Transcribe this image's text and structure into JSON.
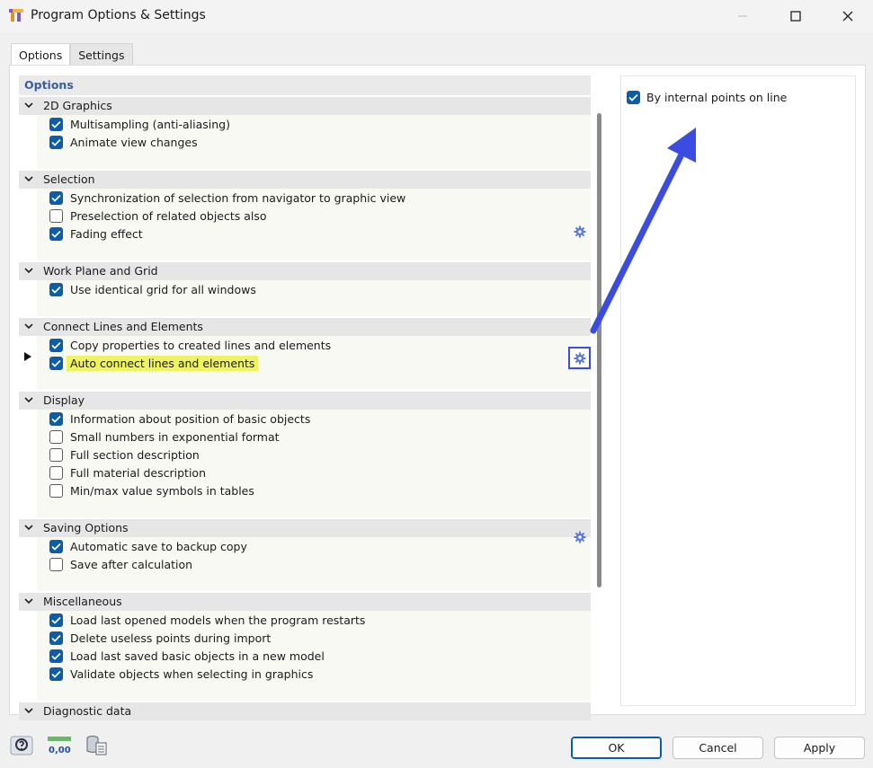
{
  "window": {
    "title": "Program Options & Settings"
  },
  "tabs": [
    {
      "label": "Options",
      "active": true
    },
    {
      "label": "Settings",
      "active": false
    }
  ],
  "options_pane": {
    "header": "Options",
    "groups": [
      {
        "title": "2D Graphics",
        "items": [
          {
            "label": "Multisampling (anti-aliasing)",
            "checked": true
          },
          {
            "label": "Animate view changes",
            "checked": true
          }
        ]
      },
      {
        "title": "Selection",
        "items": [
          {
            "label": "Synchronization of selection from navigator to graphic view",
            "checked": true
          },
          {
            "label": "Preselection of related objects also",
            "checked": false
          },
          {
            "label": "Fading effect",
            "checked": true
          }
        ]
      },
      {
        "title": "Work Plane and Grid",
        "items": [
          {
            "label": "Use identical grid for all windows",
            "checked": true
          }
        ]
      },
      {
        "title": "Connect Lines and Elements",
        "items": [
          {
            "label": "Copy properties to created lines and elements",
            "checked": true
          },
          {
            "label": "Auto connect lines and elements",
            "checked": true
          }
        ]
      },
      {
        "title": "Display",
        "items": [
          {
            "label": "Information about position of basic objects",
            "checked": true
          },
          {
            "label": "Small numbers in exponential format",
            "checked": false
          },
          {
            "label": "Full section description",
            "checked": false
          },
          {
            "label": "Full material description",
            "checked": false
          },
          {
            "label": "Min/max value symbols in tables",
            "checked": false
          }
        ]
      },
      {
        "title": "Saving Options",
        "items": [
          {
            "label": "Automatic save to backup copy",
            "checked": true
          },
          {
            "label": "Save after calculation",
            "checked": false
          }
        ]
      },
      {
        "title": "Miscellaneous",
        "items": [
          {
            "label": "Load last opened models when the program restarts",
            "checked": true
          },
          {
            "label": "Delete useless points during import",
            "checked": true
          },
          {
            "label": "Load last saved basic objects in a new model",
            "checked": true
          },
          {
            "label": "Validate objects when selecting in graphics",
            "checked": true
          }
        ]
      },
      {
        "title": "Diagnostic data",
        "items": []
      }
    ]
  },
  "detail_pane": {
    "items": [
      {
        "label": "By internal points on line",
        "checked": true
      }
    ]
  },
  "footer": {
    "ok": "OK",
    "cancel": "Cancel",
    "apply": "Apply",
    "units_icon_text": "0,00"
  },
  "colors": {
    "accent": "#0b5cad",
    "highlight": "#eef45e",
    "arrow": "#3b4de0",
    "header_text": "#3a5da0"
  },
  "icons": [
    "app-icon",
    "minimize-icon",
    "maximize-icon",
    "close-icon",
    "chevron-down-icon",
    "gear-icon",
    "help-icon",
    "units-icon",
    "database-icon",
    "arrow-annotation-icon"
  ]
}
